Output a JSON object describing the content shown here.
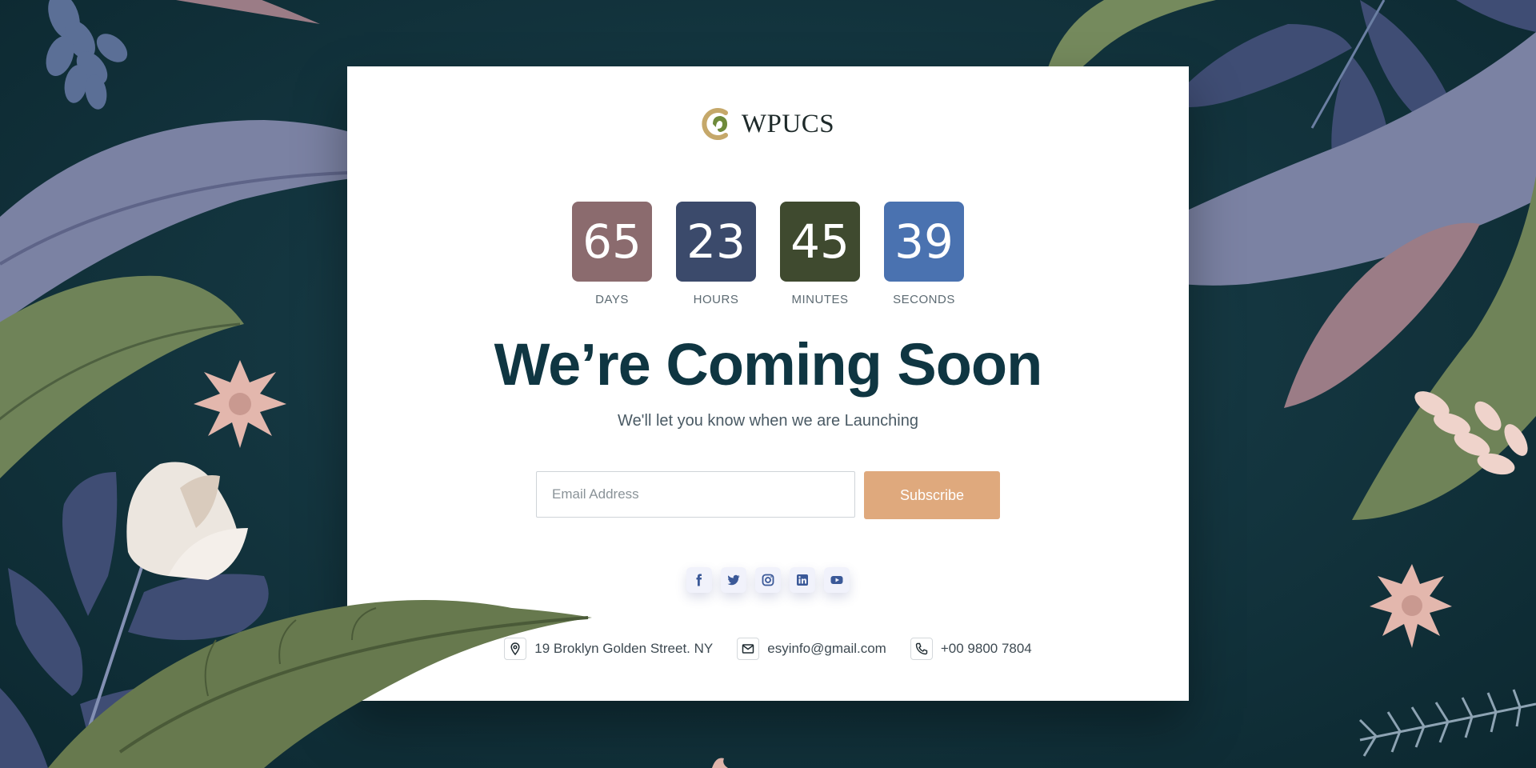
{
  "brand": {
    "name": "WPUCS"
  },
  "countdown": [
    {
      "value": "65",
      "label": "DAYS",
      "color": "#8b6b6e"
    },
    {
      "value": "23",
      "label": "HOURS",
      "color": "#3b4a6b"
    },
    {
      "value": "45",
      "label": "MINUTES",
      "color": "#3f4a2f"
    },
    {
      "value": "39",
      "label": "SECONDS",
      "color": "#4a72b0"
    }
  ],
  "headline": "We’re Coming Soon",
  "subheadline": "We'll let you know when we are Launching",
  "subscribe": {
    "placeholder": "Email Address",
    "value": "",
    "button_label": "Subscribe"
  },
  "social": [
    "facebook-icon",
    "twitter-icon",
    "instagram-icon",
    "linkedin-icon",
    "youtube-icon"
  ],
  "contact": {
    "address": "19 Broklyn Golden Street. NY",
    "email": "esyinfo@gmail.com",
    "phone": "+00 9800 7804"
  },
  "colors": {
    "background": "#143640",
    "headline": "#0f3642",
    "button": "#dfa97d",
    "social_icon": "#3b5998"
  }
}
